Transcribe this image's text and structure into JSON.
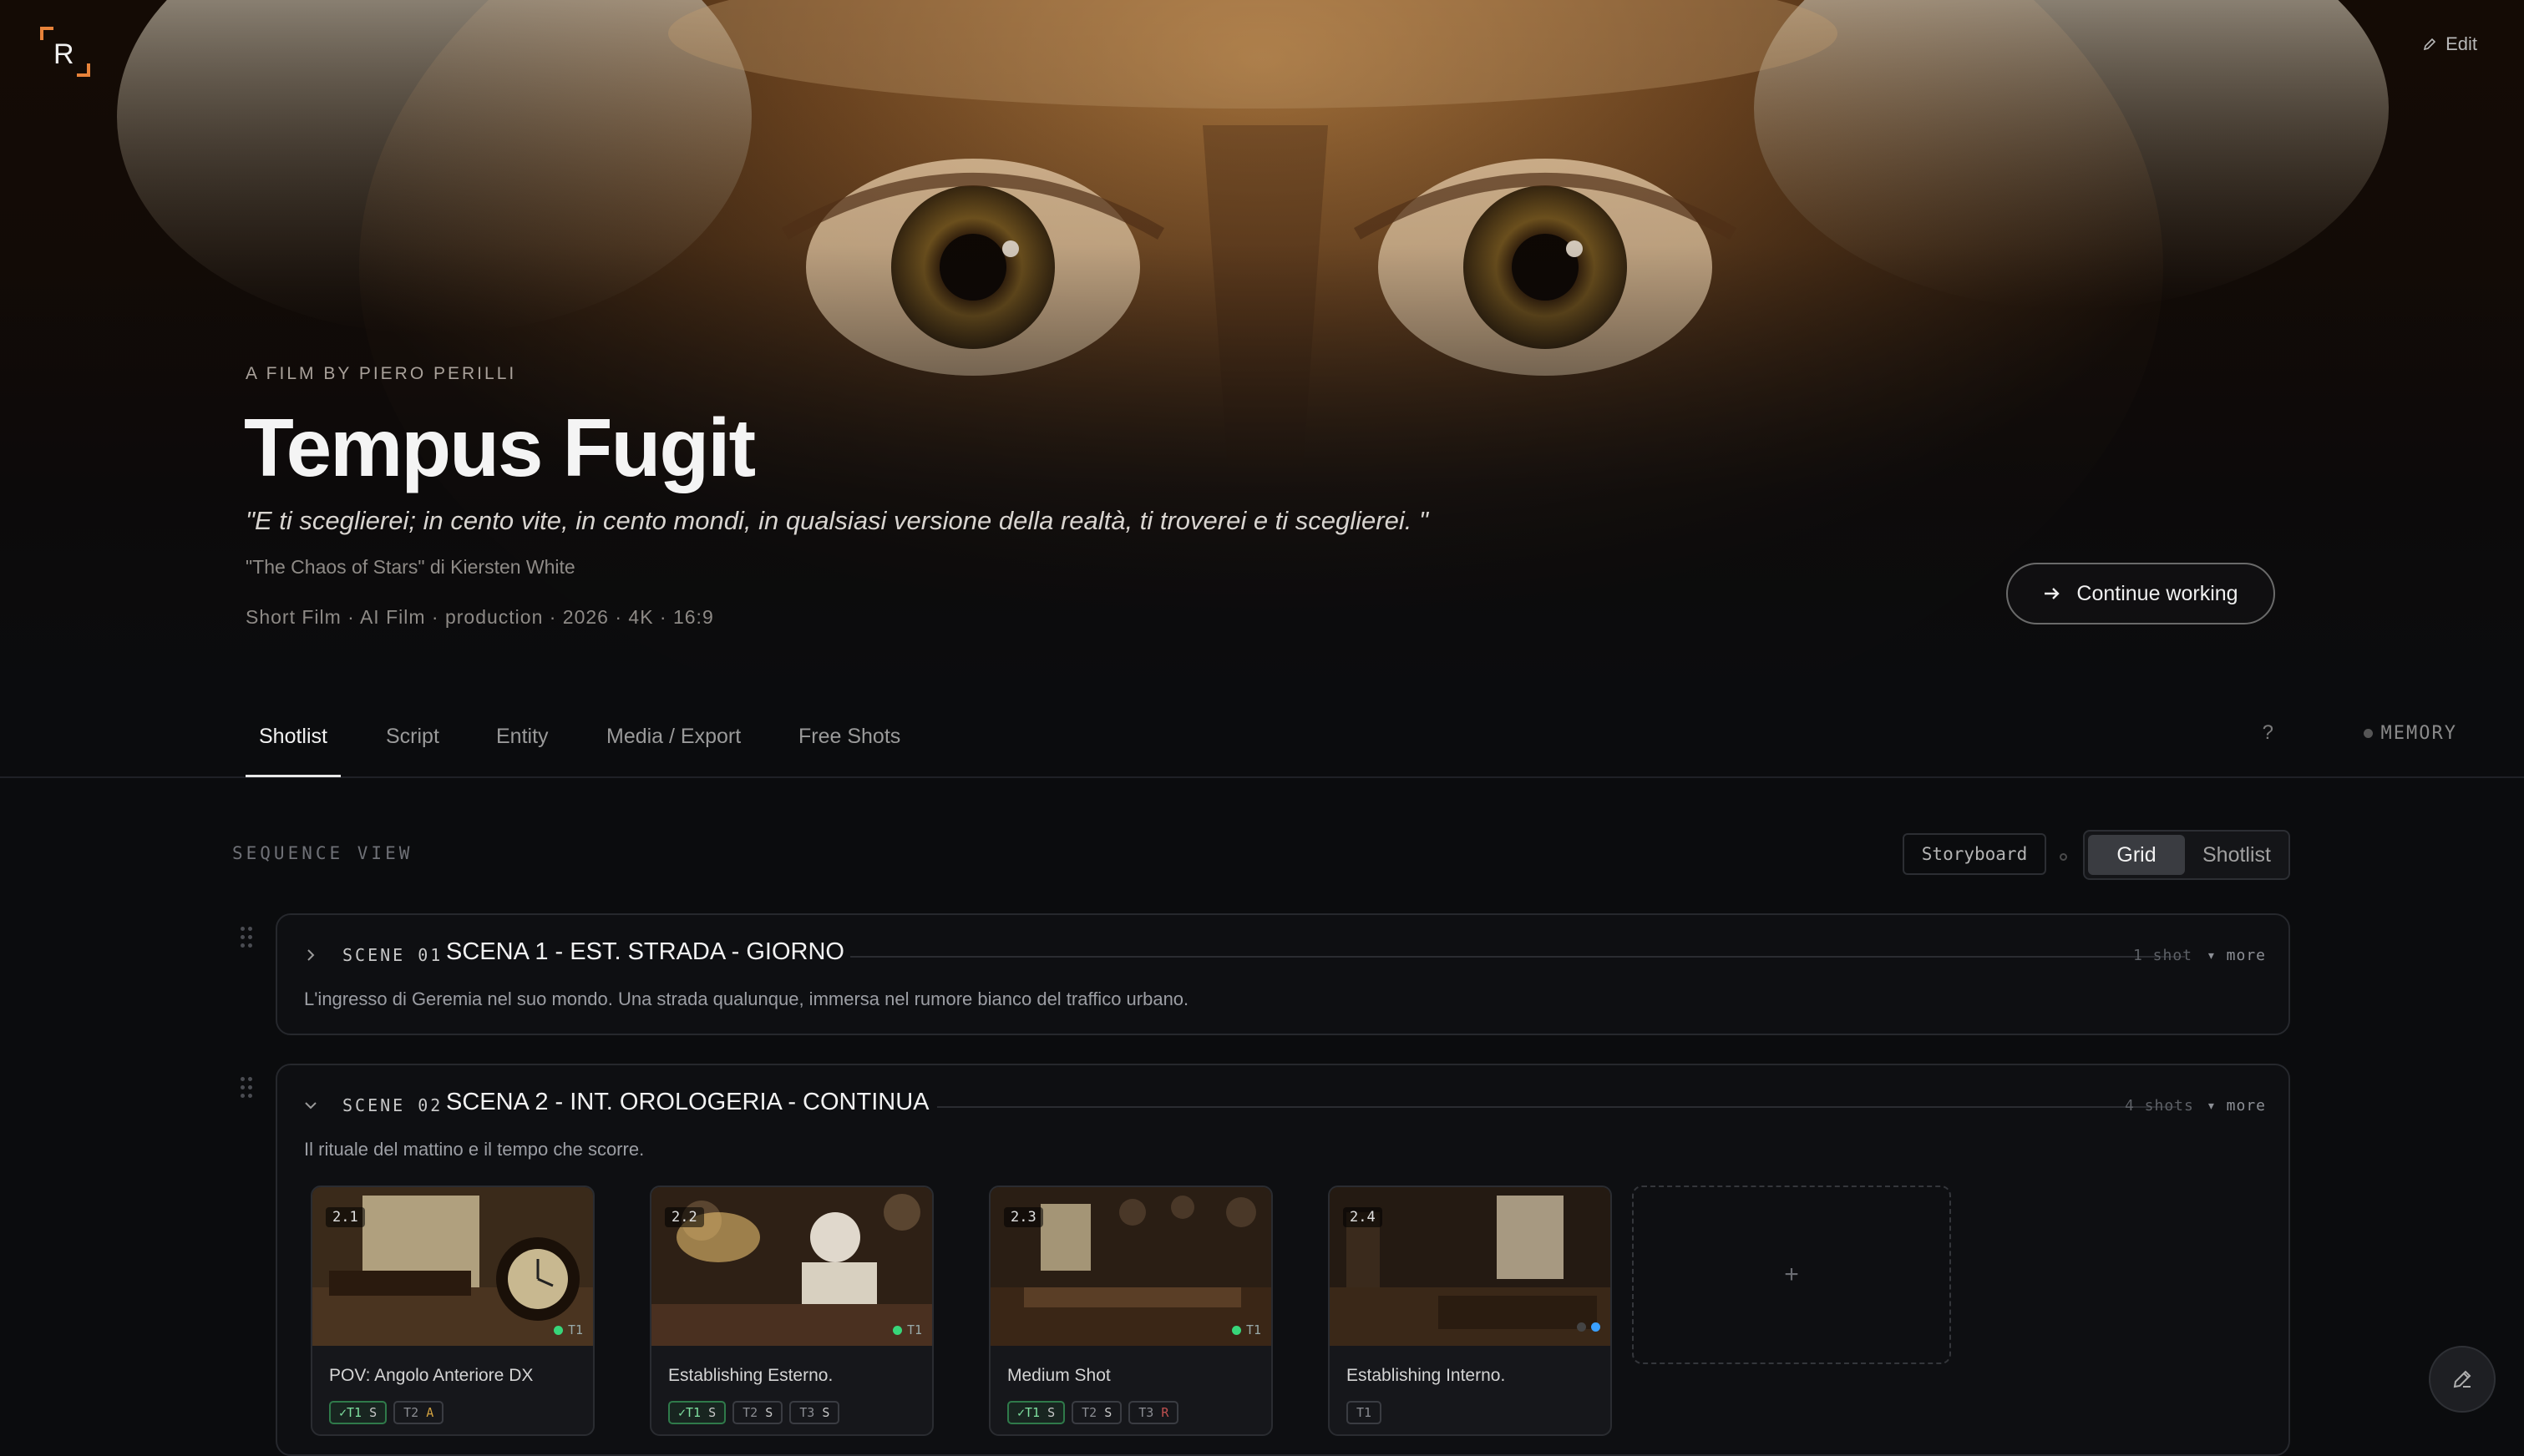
{
  "header": {
    "edit_label": "Edit"
  },
  "hero": {
    "byline": "A FILM BY PIERO PERILLI",
    "title": "Tempus Fugit",
    "quote": "\"E ti sceglierei; in cento vite, in cento mondi, in qualsiasi versione della realtà, ti troverei e ti sceglierei. \"",
    "source": "\"The Chaos of Stars\" di Kiersten White",
    "meta": "Short Film · AI Film · production · 2026 · 4K · 16:9",
    "continue_label": "Continue working"
  },
  "tabs": [
    {
      "label": "Shotlist",
      "active": true
    },
    {
      "label": "Script",
      "active": false
    },
    {
      "label": "Entity",
      "active": false
    },
    {
      "label": "Media / Export",
      "active": false
    },
    {
      "label": "Free Shots",
      "active": false
    }
  ],
  "tabbar": {
    "help": "?",
    "memory": "MEMORY"
  },
  "sequence": {
    "title": "SEQUENCE VIEW",
    "storyboard_label": "Storyboard",
    "view_options": [
      "Grid",
      "Shotlist"
    ],
    "active_view": "Grid"
  },
  "scenes": [
    {
      "label": "SCENE 01",
      "heading": "SCENA 1 - EST. STRADA - GIORNO",
      "count": "1 shot",
      "more": "▾ more",
      "description": "L'ingresso di Geremia nel suo mondo. Una strada qualunque, immersa nel rumore bianco del traffico urbano.",
      "expanded": false
    },
    {
      "label": "SCENE 02",
      "heading": "SCENA 2 - INT. OROLOGERIA - CONTINUA",
      "count": "4 shots",
      "more": "▾ more",
      "description": "Il rituale del mattino e il tempo che scorre.",
      "expanded": true,
      "shots": [
        {
          "id": "2.1",
          "name": "POV: Angolo Anteriore DX",
          "status_label": "T1",
          "tags": [
            {
              "text": "✓T1",
              "grade": "S",
              "ok": true
            },
            {
              "text": "T2",
              "grade": "A",
              "ok": false
            }
          ]
        },
        {
          "id": "2.2",
          "name": "Establishing Esterno.",
          "status_label": "T1",
          "tags": [
            {
              "text": "✓T1",
              "grade": "S",
              "ok": true
            },
            {
              "text": "T2",
              "grade": "S",
              "ok": false
            },
            {
              "text": "T3",
              "grade": "S",
              "ok": false
            }
          ]
        },
        {
          "id": "2.3",
          "name": "Medium Shot",
          "status_label": "T1",
          "tags": [
            {
              "text": "✓T1",
              "grade": "S",
              "ok": true
            },
            {
              "text": "T2",
              "grade": "S",
              "ok": false
            },
            {
              "text": "T3",
              "grade": "R",
              "ok": false
            }
          ]
        },
        {
          "id": "2.4",
          "name": "Establishing Interno.",
          "status_label": "",
          "tags": [
            {
              "text": "T1",
              "grade": "",
              "ok": false
            }
          ]
        }
      ],
      "add_label": "+"
    }
  ],
  "colors": {
    "background": "#0b0c0e",
    "status_green": "#37d67a",
    "status_blue": "#3aa0ff",
    "accent_logo": "#e8833a"
  },
  "icons": [
    "logo-icon",
    "pencil-icon",
    "arrow-right-icon",
    "chevron-right-icon",
    "chevron-down-icon",
    "drag-handle-icon",
    "plus-icon",
    "edit-pencil-icon"
  ]
}
